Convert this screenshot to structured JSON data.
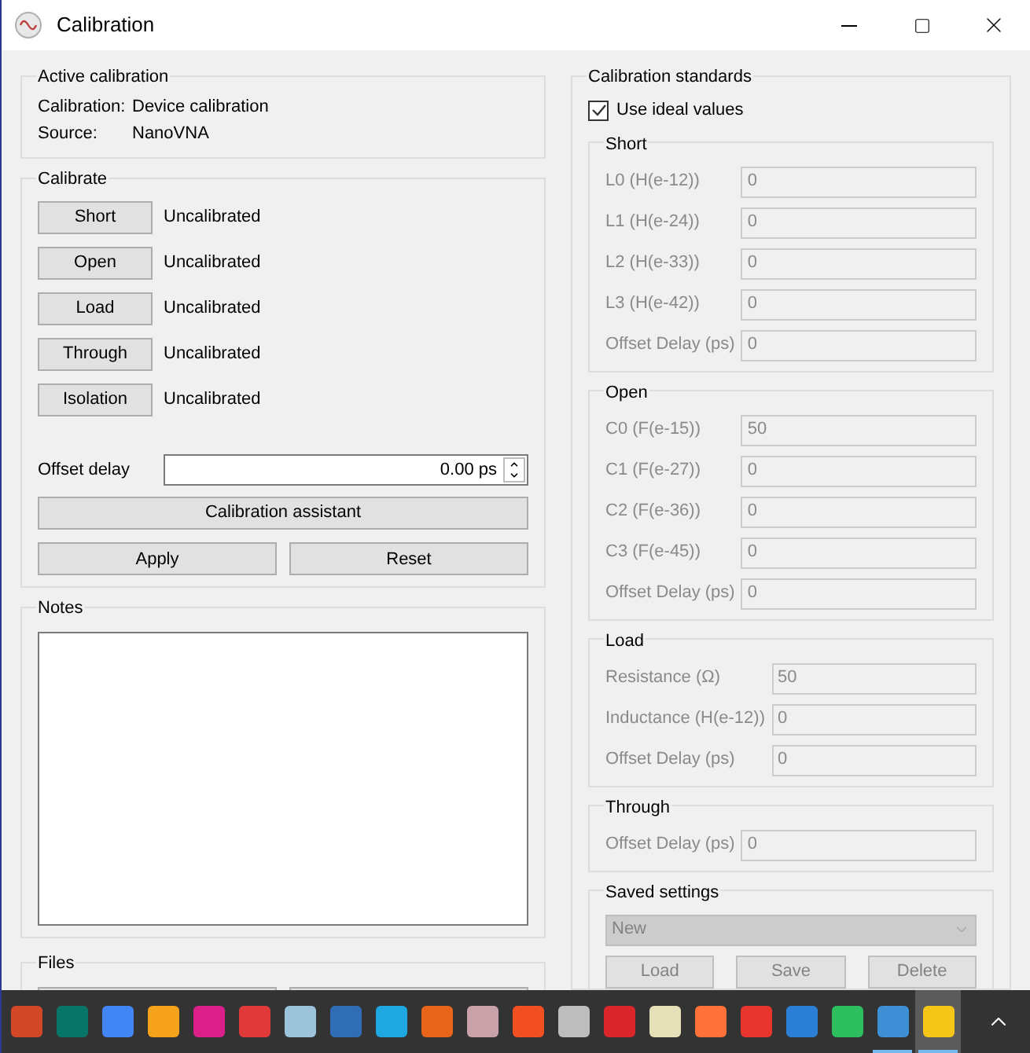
{
  "window": {
    "title": "Calibration"
  },
  "active_calibration": {
    "title": "Active calibration",
    "rows": [
      {
        "label": "Calibration:",
        "value": "Device calibration"
      },
      {
        "label": "Source:",
        "value": "NanoVNA"
      }
    ]
  },
  "calibrate": {
    "title": "Calibrate",
    "steps": [
      {
        "button": "Short",
        "status": "Uncalibrated"
      },
      {
        "button": "Open",
        "status": "Uncalibrated"
      },
      {
        "button": "Load",
        "status": "Uncalibrated"
      },
      {
        "button": "Through",
        "status": "Uncalibrated"
      },
      {
        "button": "Isolation",
        "status": "Uncalibrated"
      }
    ],
    "offset_delay": {
      "label": "Offset delay",
      "value": "0.00 ps"
    },
    "assistant_button": "Calibration assistant",
    "buttons": [
      "Apply",
      "Reset"
    ]
  },
  "notes": {
    "title": "Notes"
  },
  "files": {
    "title": "Files",
    "buttons": [
      {
        "kind": "button"
      },
      {
        "kind": "button"
      }
    ]
  },
  "standards": {
    "title": "Calibration standards",
    "use_ideal": {
      "label": "Use ideal values",
      "checked": true
    },
    "groups": [
      {
        "title": "Short",
        "fields": [
          {
            "label": "L0 (H(e-12))",
            "value": "0"
          },
          {
            "label": "L1 (H(e-24))",
            "value": "0"
          },
          {
            "label": "L2 (H(e-33))",
            "value": "0"
          },
          {
            "label": "L3 (H(e-42))",
            "value": "0"
          },
          {
            "label": "Offset Delay (ps)",
            "value": "0"
          }
        ]
      },
      {
        "title": "Open",
        "fields": [
          {
            "label": "C0 (F(e-15))",
            "value": "50"
          },
          {
            "label": "C1 (F(e-27))",
            "value": "0"
          },
          {
            "label": "C2 (F(e-36))",
            "value": "0"
          },
          {
            "label": "C3 (F(e-45))",
            "value": "0"
          },
          {
            "label": "Offset Delay (ps)",
            "value": "0"
          }
        ]
      },
      {
        "title": "Load",
        "fields": [
          {
            "label": "Resistance (Ω)",
            "value": "50"
          },
          {
            "label": "Inductance (H(e-12))",
            "value": "0"
          },
          {
            "label": "Offset Delay (ps)",
            "value": "0"
          }
        ]
      },
      {
        "title": "Through",
        "fields": [
          {
            "label": "Offset Delay (ps)",
            "value": "0"
          }
        ]
      }
    ],
    "saved": {
      "title": "Saved settings",
      "select": {
        "value": "New",
        "disabled": true
      },
      "buttons": [
        "Load",
        "Save",
        "Delete"
      ]
    }
  },
  "taskbar": {
    "apps": [
      {
        "color": "#d24726",
        "running": false,
        "selected": false
      },
      {
        "color": "#077568",
        "running": false,
        "selected": false
      },
      {
        "color": "#4285f4",
        "running": false,
        "selected": false
      },
      {
        "color": "#f7a21b",
        "running": false,
        "selected": false
      },
      {
        "color": "#da1f89",
        "running": false,
        "selected": false
      },
      {
        "color": "#e03a3a",
        "running": false,
        "selected": false
      },
      {
        "color": "#9cc3d9",
        "running": false,
        "selected": false
      },
      {
        "color": "#2f6db5",
        "running": false,
        "selected": false
      },
      {
        "color": "#1ea7e1",
        "running": false,
        "selected": false
      },
      {
        "color": "#e8641b",
        "running": false,
        "selected": false
      },
      {
        "color": "#c8a2a8",
        "running": false,
        "selected": false
      },
      {
        "color": "#f25022",
        "running": false,
        "selected": false
      },
      {
        "color": "#bdbdbd",
        "running": false,
        "selected": false
      },
      {
        "color": "#d8262c",
        "running": false,
        "selected": false
      },
      {
        "color": "#e6e0b8",
        "running": false,
        "selected": false
      },
      {
        "color": "#ff7139",
        "running": false,
        "selected": false
      },
      {
        "color": "#e8352d",
        "running": false,
        "selected": false
      },
      {
        "color": "#2a7fd4",
        "running": false,
        "selected": false
      },
      {
        "color": "#2dbe60",
        "running": false,
        "selected": false
      },
      {
        "color": "#3f8fd6",
        "running": true,
        "selected": false
      },
      {
        "color": "#f5c518",
        "running": true,
        "selected": true
      }
    ]
  }
}
